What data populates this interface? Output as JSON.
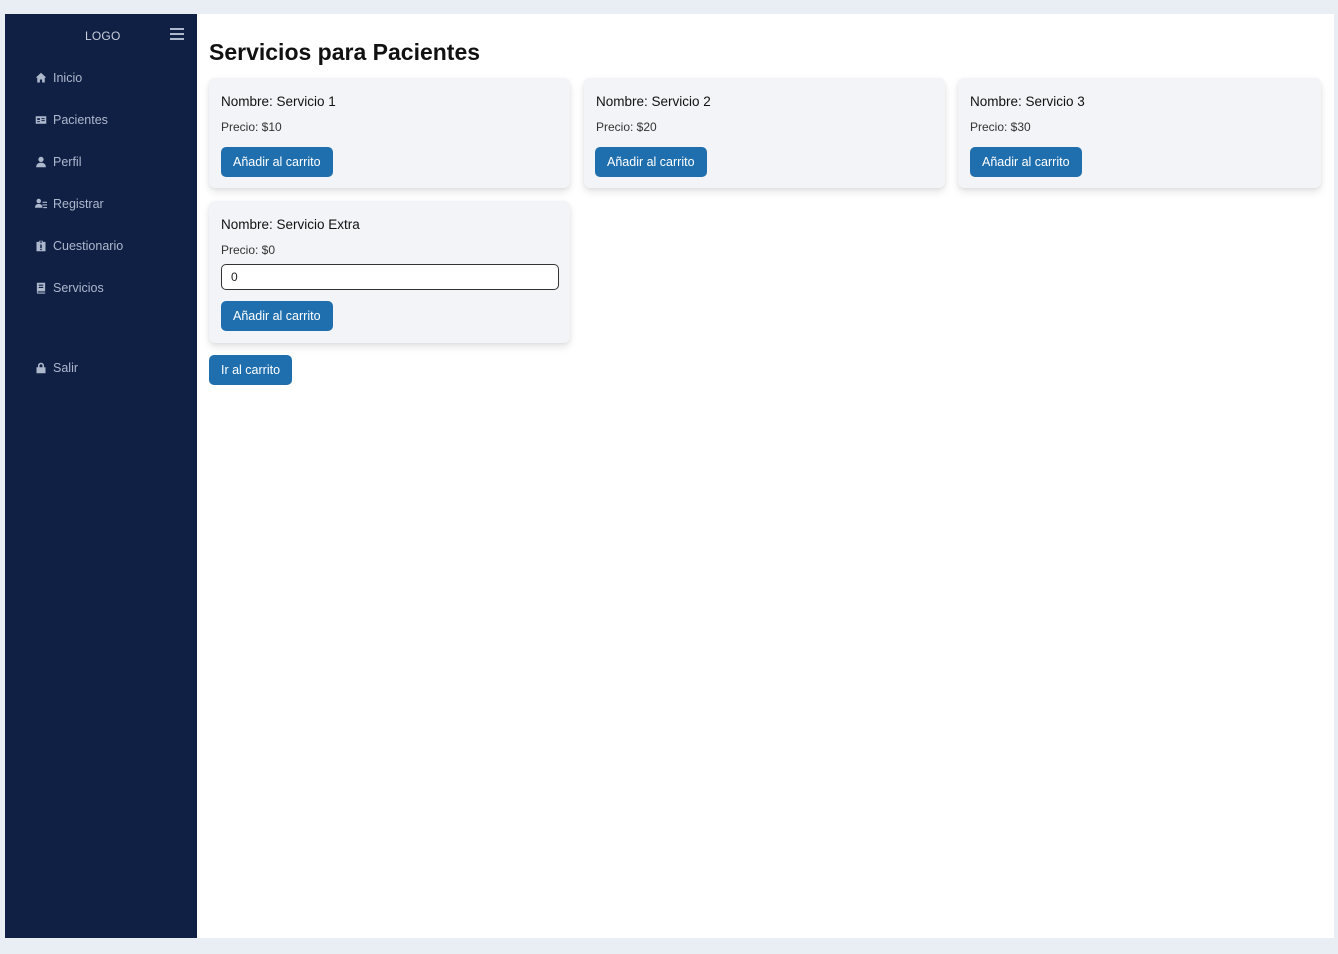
{
  "sidebar": {
    "logo": "LOGO",
    "menu_icon": "hamburger-icon",
    "items": [
      {
        "label": "Inicio",
        "icon": "home-icon"
      },
      {
        "label": "Pacientes",
        "icon": "id-card-icon"
      },
      {
        "label": "Perfil",
        "icon": "user-icon"
      },
      {
        "label": "Registrar",
        "icon": "user-register-icon"
      },
      {
        "label": "Cuestionario",
        "icon": "clipboard-icon"
      },
      {
        "label": "Servicios",
        "icon": "book-icon"
      }
    ],
    "logout": {
      "label": "Salir",
      "icon": "lock-icon"
    }
  },
  "main": {
    "title": "Servicios para Pacientes",
    "cards": [
      {
        "name": "Nombre: Servicio 1",
        "price": "Precio: $10",
        "button": "Añadir al carrito"
      },
      {
        "name": "Nombre: Servicio 2",
        "price": "Precio: $20",
        "button": "Añadir al carrito"
      },
      {
        "name": "Nombre: Servicio 3",
        "price": "Precio: $30",
        "button": "Añadir al carrito"
      },
      {
        "name": "Nombre: Servicio Extra",
        "price": "Precio: $0",
        "input_value": "0",
        "button": "Añadir al carrito"
      }
    ],
    "cart_button": "Ir al carrito"
  },
  "colors": {
    "sidebar_bg": "#102044",
    "button_bg": "#1f6fae",
    "card_bg": "#f3f4f7",
    "page_bg": "#e9eef5"
  }
}
